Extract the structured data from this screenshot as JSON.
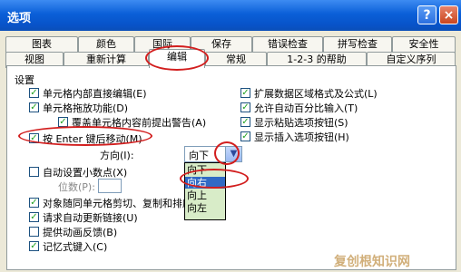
{
  "window": {
    "title": "选项",
    "help_icon": "?",
    "close_icon": "×"
  },
  "tabs_row1": [
    "图表",
    "颜色",
    "国际",
    "保存",
    "错误检查",
    "拼写检查",
    "安全性"
  ],
  "tabs_row2": [
    "视图",
    "重新计算",
    "编辑",
    "常规",
    "1-2-3 的帮助",
    "自定义序列"
  ],
  "group_label": "设置",
  "left_options": [
    {
      "label": "单元格内部直接编辑(E)",
      "checked": true
    },
    {
      "label": "单元格拖放功能(D)",
      "checked": true
    },
    {
      "label": "覆盖单元格内容前提出警告(A)",
      "checked": true
    },
    {
      "label": "按 Enter 键后移动(M)",
      "checked": true
    },
    {
      "label": "方向(I):",
      "checked": false
    },
    {
      "label": "自动设置小数点(X)",
      "checked": false
    },
    {
      "label": "位数(P):",
      "checked": false
    },
    {
      "label": "对象随同单元格剪切、复制和排序",
      "checked": true
    },
    {
      "label": "请求自动更新链接(U)",
      "checked": true
    },
    {
      "label": "提供动画反馈(B)",
      "checked": false
    },
    {
      "label": "记忆式键入(C)",
      "checked": true
    }
  ],
  "right_options": [
    {
      "label": "扩展数据区域格式及公式(L)",
      "checked": true
    },
    {
      "label": "允许自动百分比输入(T)",
      "checked": true
    },
    {
      "label": "显示粘贴选项按钮(S)",
      "checked": true
    },
    {
      "label": "显示插入选项按钮(H)",
      "checked": true
    }
  ],
  "direction_select": {
    "value": "向下",
    "options": [
      "向下",
      "向右",
      "向上",
      "向左"
    ],
    "highlighted": "向右"
  },
  "watermark": "复创根知识网"
}
